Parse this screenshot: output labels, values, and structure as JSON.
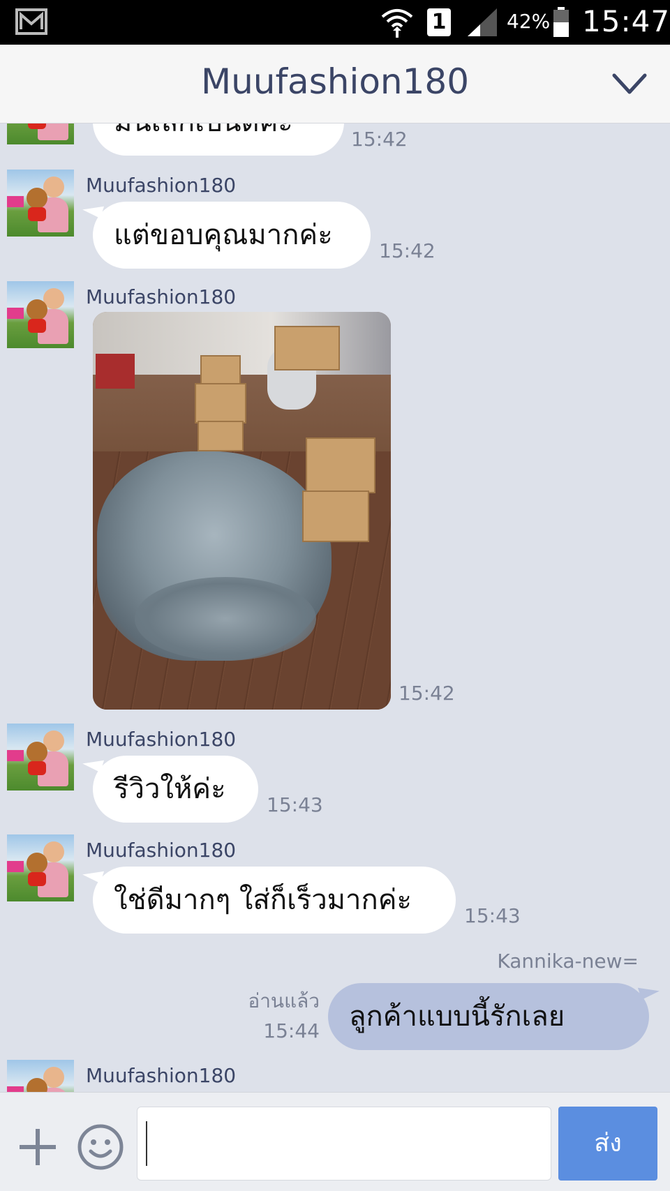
{
  "status_bar": {
    "battery": "42%",
    "time": "15:47",
    "sim": "1"
  },
  "header": {
    "title": "Muufashion180"
  },
  "messages": [
    {
      "text": "มันเล็กเป็นดีค่ะ",
      "time": "15:42"
    },
    {
      "sender": "Muufashion180",
      "text": "แต่ขอบคุณมากค่ะ",
      "time": "15:42"
    },
    {
      "sender": "Muufashion180",
      "time": "15:42"
    },
    {
      "sender": "Muufashion180",
      "text": "รีวิวให้ค่ะ",
      "time": "15:43"
    },
    {
      "sender": "Muufashion180",
      "text": "ใช่ดีมากๆ ใส่ก็เร็วมากค่ะ",
      "time": "15:43"
    },
    {
      "sender": "Kannika-new=",
      "text": "ลูกค้าแบบนี้รักเลย",
      "read_label": "อ่านแล้ว",
      "time": "15:44"
    },
    {
      "sender": "Muufashion180"
    }
  ],
  "input": {
    "value": "",
    "send_label": "ส่ง"
  },
  "icons": [
    "gmail-icon",
    "wifi-icon",
    "sim-icon",
    "signal-icon",
    "battery-icon",
    "chevron-down-icon",
    "plus-icon",
    "emoji-icon"
  ],
  "colors": {
    "header_title": "#3b4566",
    "chat_bg": "#dde1ea",
    "outgoing_bubble": "#b6c1dd",
    "send_button": "#5b8ee0"
  }
}
